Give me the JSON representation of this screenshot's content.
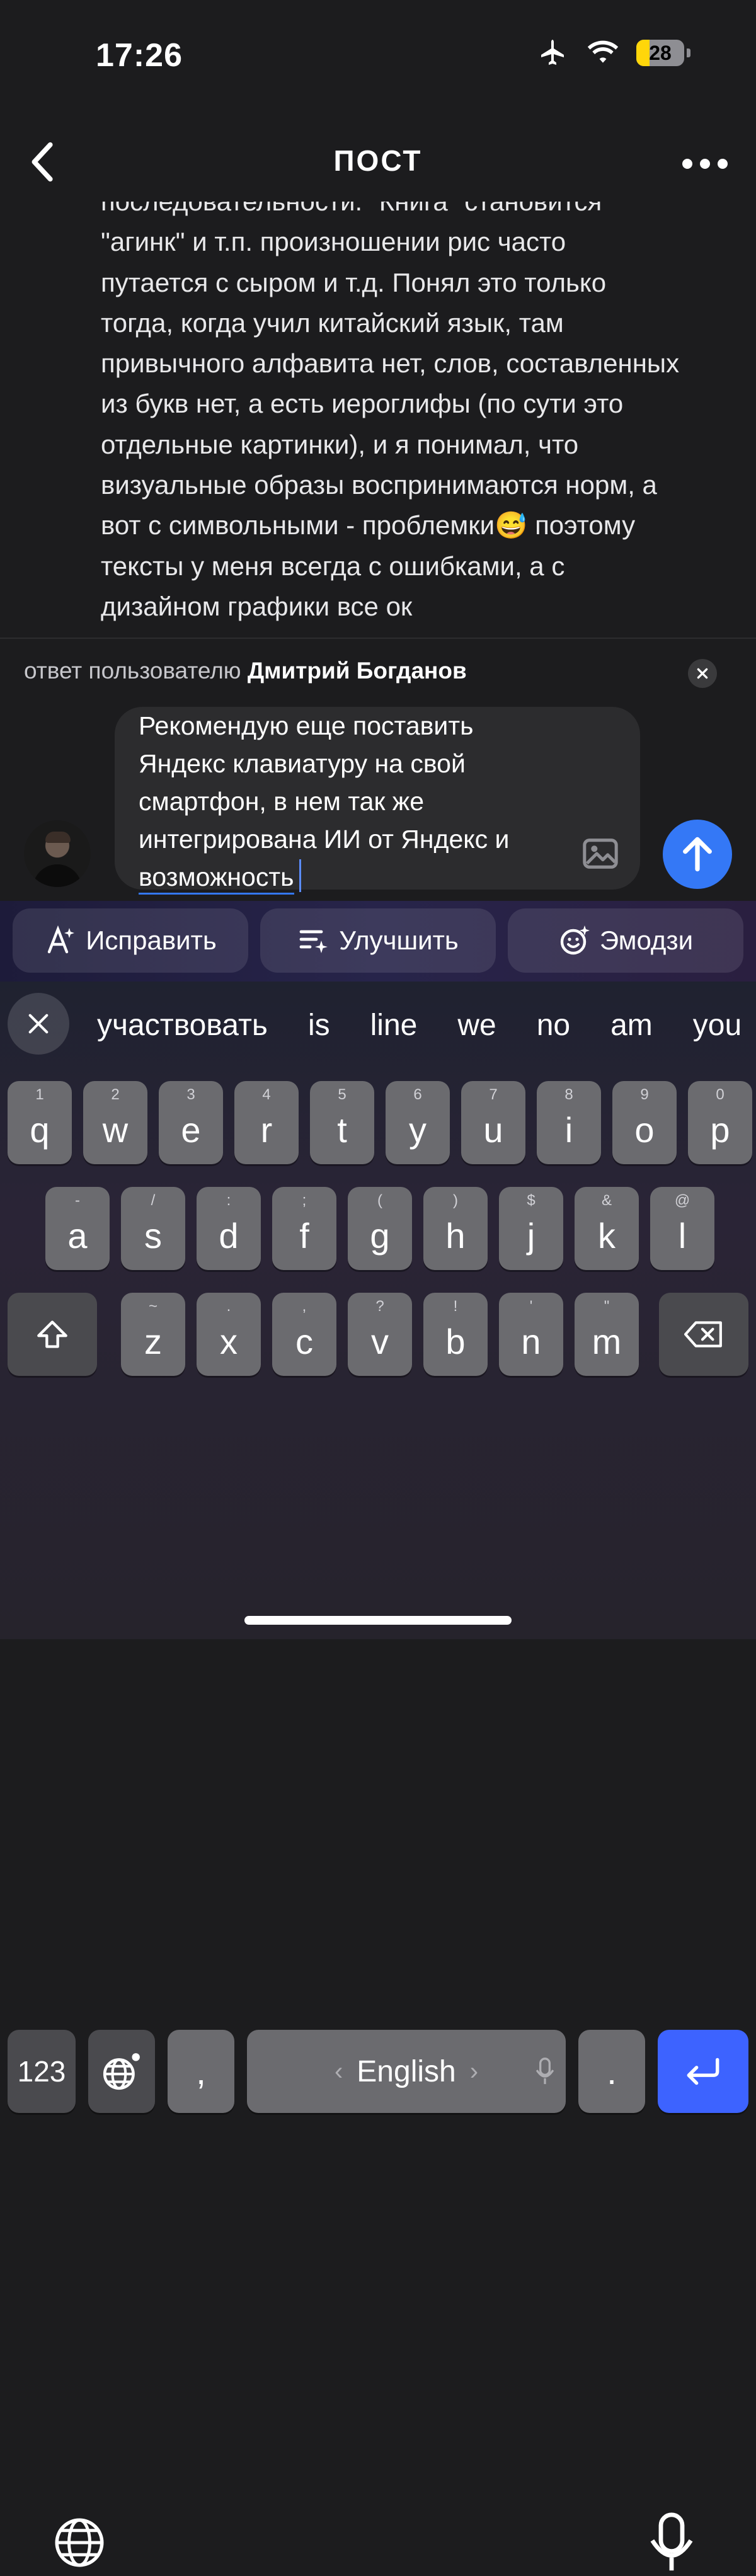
{
  "status": {
    "time": "17:26",
    "battery": "28"
  },
  "nav": {
    "title": "пост"
  },
  "post": {
    "text": "последовательности. \"Книга\" становится\n\"агинк\" и т.п. произношении рис часто\nпутается с сыром и т.д. Понял это только\nтогда, когда учил китайский язык, там\nпривычного алфавита нет, слов, составленных\nиз букв нет, а есть иероглифы (по сути это\nотдельные картинки), и я понимал, что\nвизуальные образы воспринимаются норм, а\nвот с символьными - проблемки😅 поэтому\nтексты у меня всегда с ошибками, а с\nдизайном графики все ок"
  },
  "reply": {
    "prefix": "ответ пользователю",
    "user": "Дмитрий Богданов"
  },
  "composer": {
    "text": "Рекомендую еще поставить\nЯндекс клавиатуру на свой\nсмартфон, в нем так же\nинтегрирована ИИ от Яндекс и\n",
    "last_word": "возможность"
  },
  "ai_actions": {
    "fix": "Исправить",
    "improve": "Улучшить",
    "emoji": "Эмодзи"
  },
  "suggestions": [
    "участвовать",
    "is",
    "line",
    "we",
    "no",
    "am",
    "you"
  ],
  "keyboard": {
    "row1": [
      [
        "q",
        "1"
      ],
      [
        "w",
        "2"
      ],
      [
        "e",
        "3"
      ],
      [
        "r",
        "4"
      ],
      [
        "t",
        "5"
      ],
      [
        "y",
        "6"
      ],
      [
        "u",
        "7"
      ],
      [
        "i",
        "8"
      ],
      [
        "o",
        "9"
      ],
      [
        "p",
        "0"
      ]
    ],
    "row2": [
      [
        "a",
        "-"
      ],
      [
        "s",
        "/"
      ],
      [
        "d",
        ":"
      ],
      [
        "f",
        ";"
      ],
      [
        "g",
        "("
      ],
      [
        "h",
        ")"
      ],
      [
        "j",
        "$"
      ],
      [
        "k",
        "&"
      ],
      [
        "l",
        "@"
      ]
    ],
    "row3": [
      [
        "z",
        "~"
      ],
      [
        "x",
        "."
      ],
      [
        "c",
        ","
      ],
      [
        "v",
        "?"
      ],
      [
        "b",
        "!"
      ],
      [
        "n",
        "'"
      ],
      [
        "m",
        "\""
      ]
    ],
    "numbers_label": "123",
    "comma": ",",
    "space_label": "English",
    "period": "."
  },
  "colors": {
    "accent": "#3478f6",
    "return": "#3d63ff",
    "battery": "#ffd60a"
  }
}
